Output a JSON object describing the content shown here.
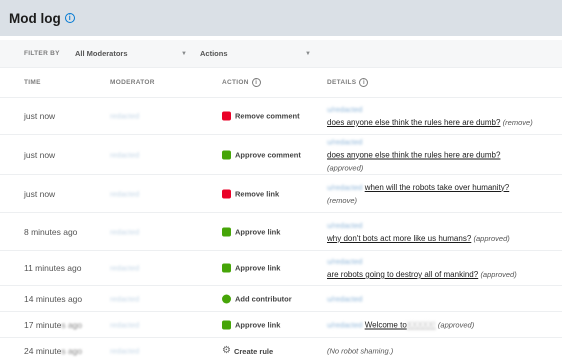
{
  "header": {
    "title": "Mod log",
    "info_icon": "info-icon"
  },
  "filters": {
    "label": "FILTER BY",
    "moderator_dropdown": "All Moderators",
    "actions_dropdown": "Actions"
  },
  "columns": {
    "time": "TIME",
    "moderator": "MODERATOR",
    "action": "ACTION",
    "details": "DETAILS"
  },
  "rows": [
    {
      "time": "just now",
      "moderator": "redacted",
      "action": "Remove comment",
      "action_icon": "remove-icon",
      "user": "u/redacted",
      "post": "does anyone else think the rules here are dumb?",
      "note": "(remove)"
    },
    {
      "time": "just now",
      "moderator": "redacted",
      "action": "Approve comment",
      "action_icon": "approve-icon",
      "user": "u/redacted",
      "post": "does anyone else think the rules here are dumb?",
      "note": "(approved)"
    },
    {
      "time": "just now",
      "moderator": "redacted",
      "action": "Remove link",
      "action_icon": "remove-icon",
      "user": "u/redacted",
      "post": "when will the robots take over humanity?",
      "note": "(remove)"
    },
    {
      "time": "8 minutes ago",
      "moderator": "redacted",
      "action": "Approve link",
      "action_icon": "approve-icon",
      "user": "u/redacted",
      "post": "why don't bots act more like us humans?",
      "note": "(approved)"
    },
    {
      "time": "11 minutes ago",
      "moderator": "redacted",
      "action": "Approve link",
      "action_icon": "approve-icon",
      "user": "u/redacted",
      "post": "are robots going to destroy all of mankind?",
      "note": "(approved)"
    },
    {
      "time": "14 minutes ago",
      "moderator": "redacted",
      "action": "Add contributor",
      "action_icon": "add-user-icon",
      "user": "u/redacted",
      "post": "",
      "note": ""
    },
    {
      "time": "17 minute",
      "moderator": "redacted",
      "action": "Approve link",
      "action_icon": "approve-icon",
      "user": "u/redacted",
      "post": "Welcome to",
      "note": "(approved)"
    },
    {
      "time": "24 minute",
      "moderator": "redacted",
      "action": "Create rule",
      "action_icon": "gear-icon",
      "user": "",
      "post": "",
      "note": "(No robot shaming.)"
    }
  ],
  "colors": {
    "accent": "#0079d3",
    "remove": "#ea0027",
    "approve": "#46a508"
  }
}
